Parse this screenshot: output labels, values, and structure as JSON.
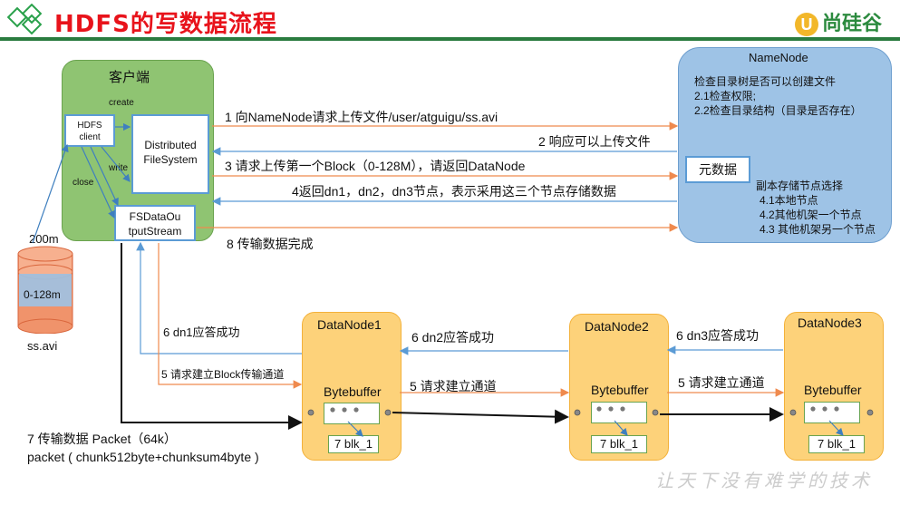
{
  "header": {
    "title": "HDFS的写数据流程",
    "brand": "尚硅谷",
    "watermark": "让天下没有难学的技术"
  },
  "client": {
    "label": "客户端",
    "hdfs_client": "HDFS\nclient",
    "dfs": "Distributed\nFileSystem",
    "fsdos": "FSDataOu\ntputStream",
    "create": "create",
    "write": "write",
    "close": "close"
  },
  "file": {
    "size_label": "200m",
    "block_label": "0-128m",
    "name": "ss.avi"
  },
  "namenode": {
    "title": "NameNode",
    "check1": "检查目录树是否可以创建文件",
    "check2": "2.1检查权限;",
    "check3": "2.2检查目录结构（目录是否存在）",
    "meta": "元数据",
    "replica_title": "副本存储节点选择",
    "replica1": "4.1本地节点",
    "replica2": "4.2其他机架一个节点",
    "replica3": "4.3 其他机架另一个节点"
  },
  "messages": {
    "m1": "1 向NameNode请求上传文件/user/atguigu/ss.avi",
    "m2": "2 响应可以上传文件",
    "m3": "3 请求上传第一个Block（0-128M），请返回DataNode",
    "m4": "4返回dn1，dn2，dn3节点，表示采用这三个节点存储数据",
    "m8": "8 传输数据完成",
    "ack1": "6 dn1应答成功",
    "ack2": "6 dn2应答成功",
    "ack3": "6 dn3应答成功",
    "req_block": "5 请求建立Block传输通道",
    "req2": "5 请求建立通道",
    "req3": "5 请求建立通道",
    "packet1": "7 传输数据  Packet（64k）",
    "packet2": "packet ( chunk512byte+chunksum4byte )"
  },
  "datanodes": [
    {
      "title": "DataNode1",
      "buffer": "Bytebuffer",
      "blk": "7 blk_1"
    },
    {
      "title": "DataNode2",
      "buffer": "Bytebuffer",
      "blk": "7 blk_1"
    },
    {
      "title": "DataNode3",
      "buffer": "Bytebuffer",
      "blk": "7 blk_1"
    }
  ]
}
